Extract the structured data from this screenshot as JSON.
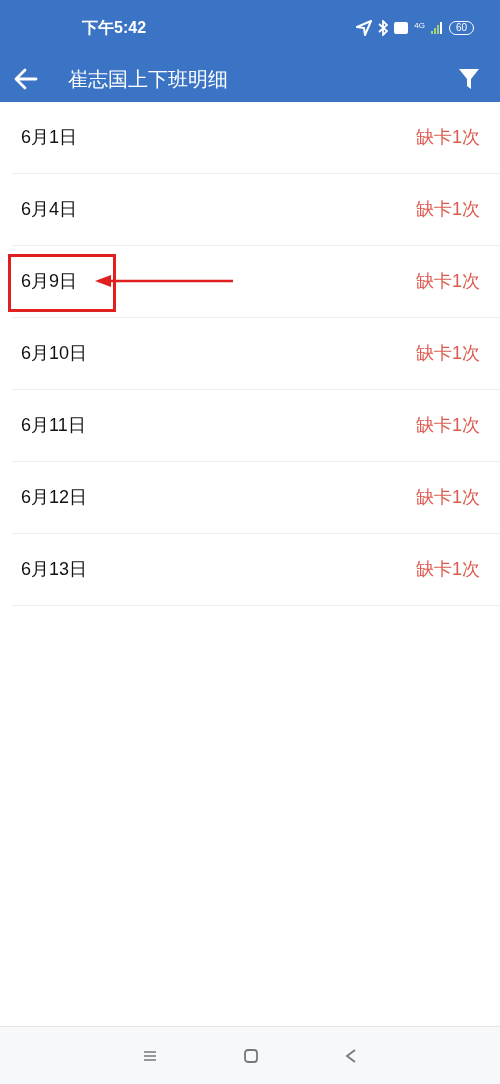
{
  "status_bar": {
    "time": "下午5:42",
    "battery": "60",
    "network": "4G"
  },
  "header": {
    "title": "崔志国上下班明细"
  },
  "records": [
    {
      "date": "6月1日",
      "status": "缺卡1次",
      "highlighted": false
    },
    {
      "date": "6月4日",
      "status": "缺卡1次",
      "highlighted": false
    },
    {
      "date": "6月9日",
      "status": "缺卡1次",
      "highlighted": true
    },
    {
      "date": "6月10日",
      "status": "缺卡1次",
      "highlighted": false
    },
    {
      "date": "6月11日",
      "status": "缺卡1次",
      "highlighted": false
    },
    {
      "date": "6月12日",
      "status": "缺卡1次",
      "highlighted": false
    },
    {
      "date": "6月13日",
      "status": "缺卡1次",
      "highlighted": false
    }
  ]
}
